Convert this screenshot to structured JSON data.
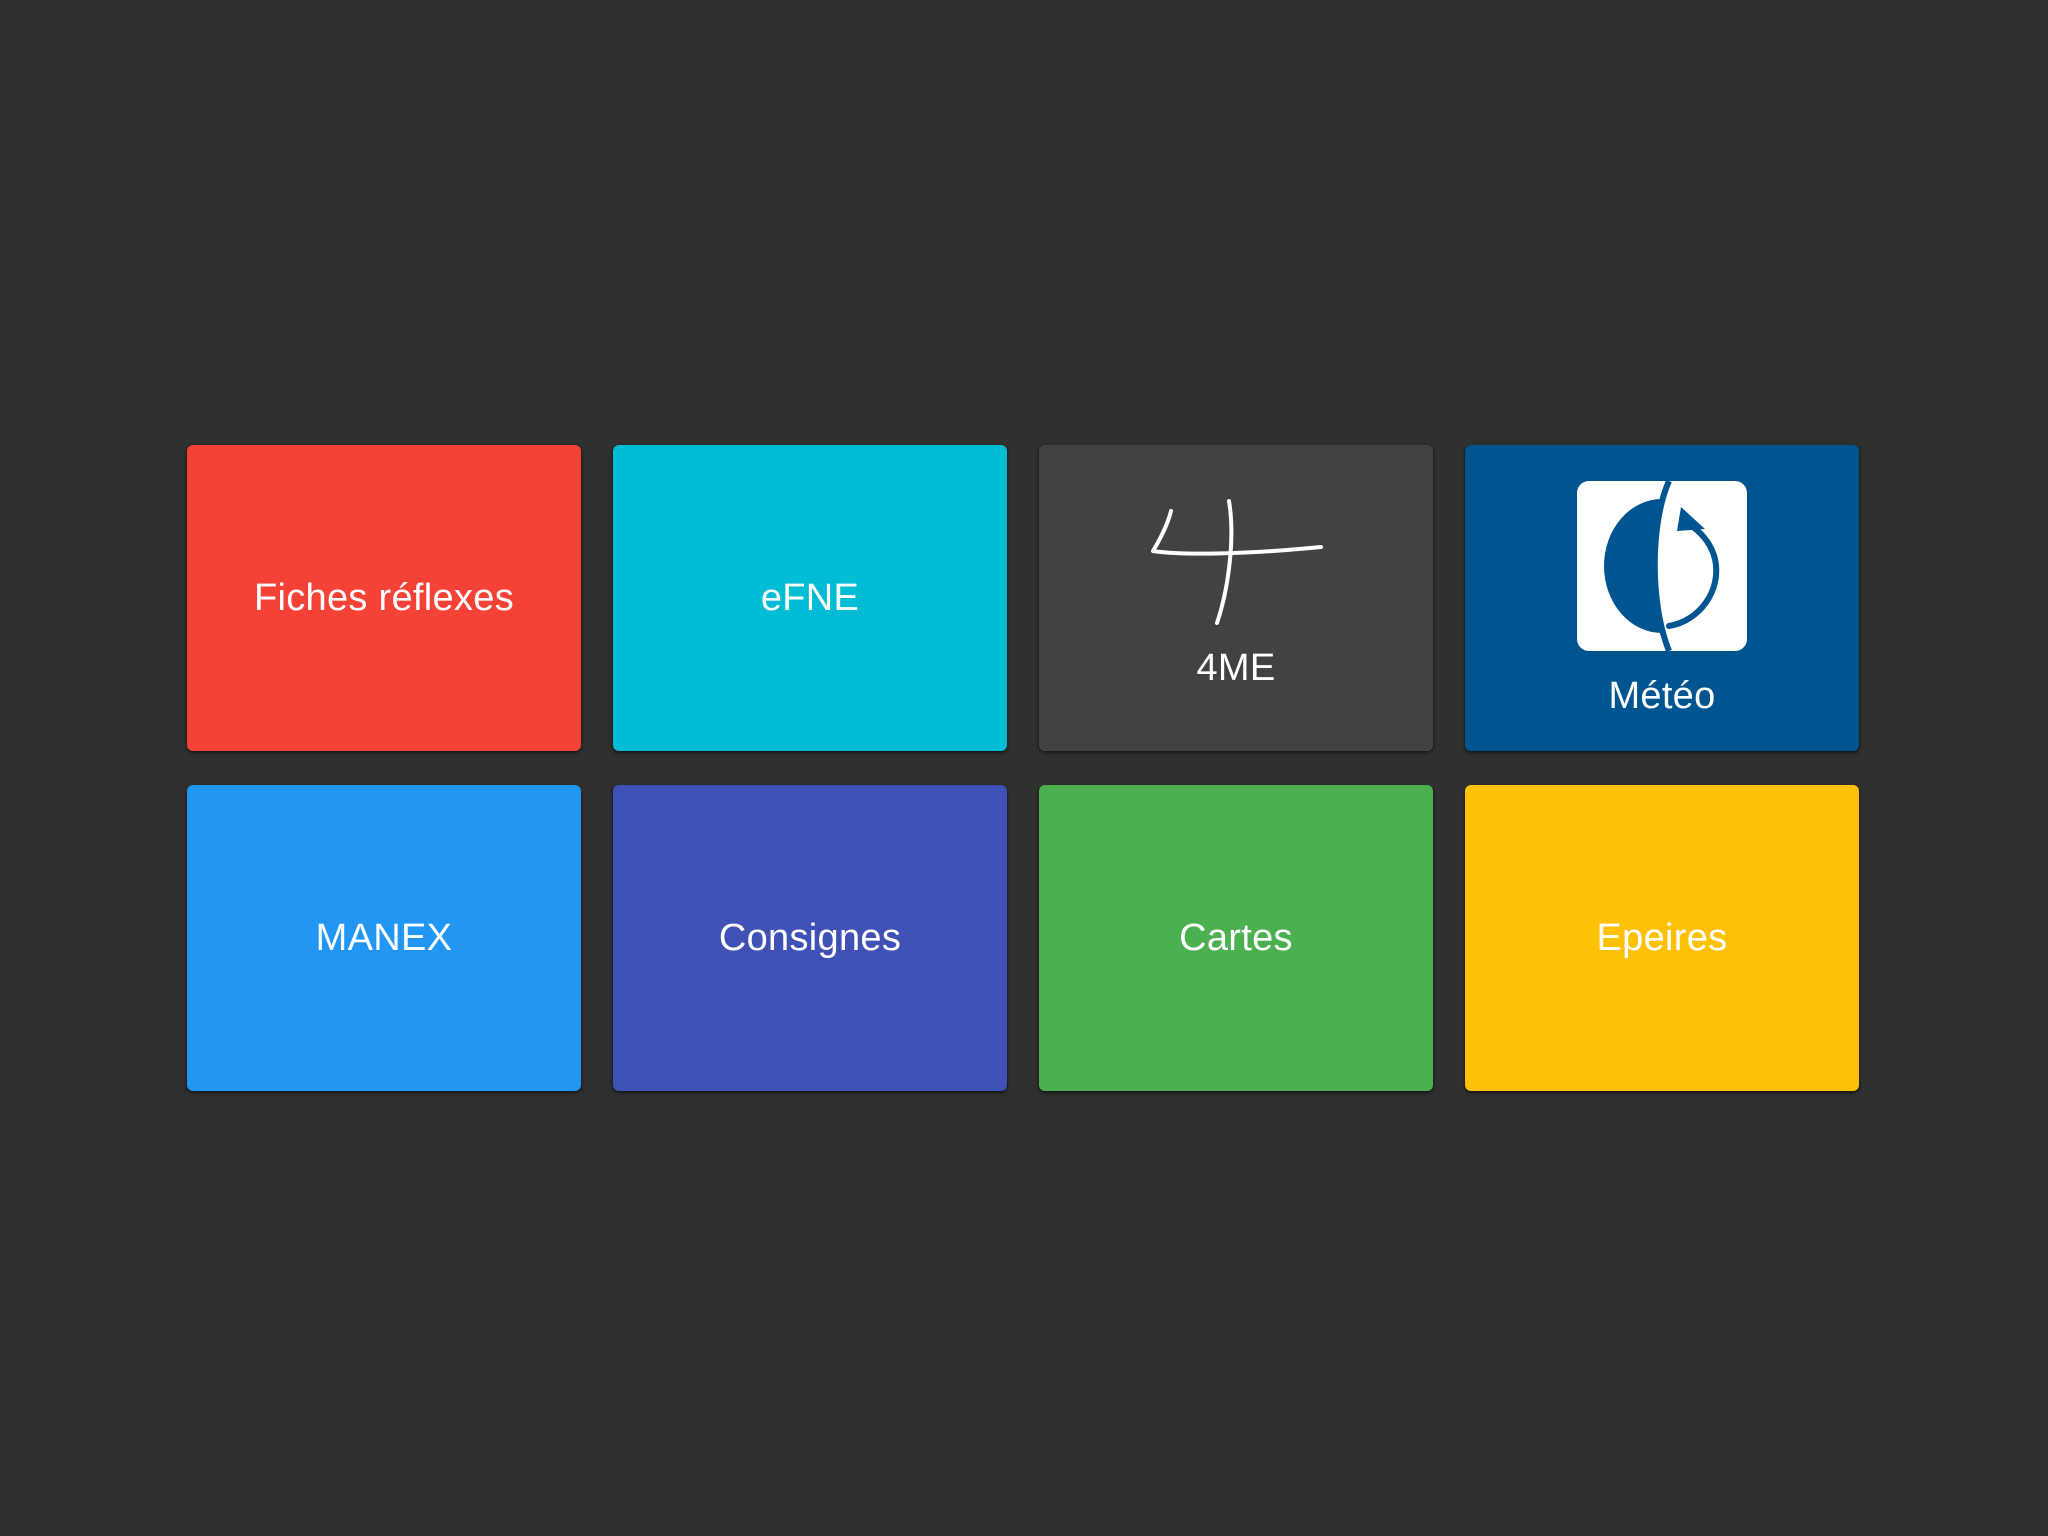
{
  "tiles": [
    {
      "label": "Fiches réflexes",
      "color": "#f44336",
      "icon": null
    },
    {
      "label": "eFNE",
      "color": "#00bcd4",
      "icon": null
    },
    {
      "label": "4ME",
      "color": "#424242",
      "icon": "4me-logo-icon"
    },
    {
      "label": "Météo",
      "color": "#00548f",
      "icon": "meteo-logo-icon"
    },
    {
      "label": "MANEX",
      "color": "#2196f3",
      "icon": null
    },
    {
      "label": "Consignes",
      "color": "#3f51b5",
      "icon": null
    },
    {
      "label": "Cartes",
      "color": "#4caf50",
      "icon": null
    },
    {
      "label": "Epeires",
      "color": "#ffc107",
      "icon": null
    }
  ],
  "background_color": "#303030"
}
